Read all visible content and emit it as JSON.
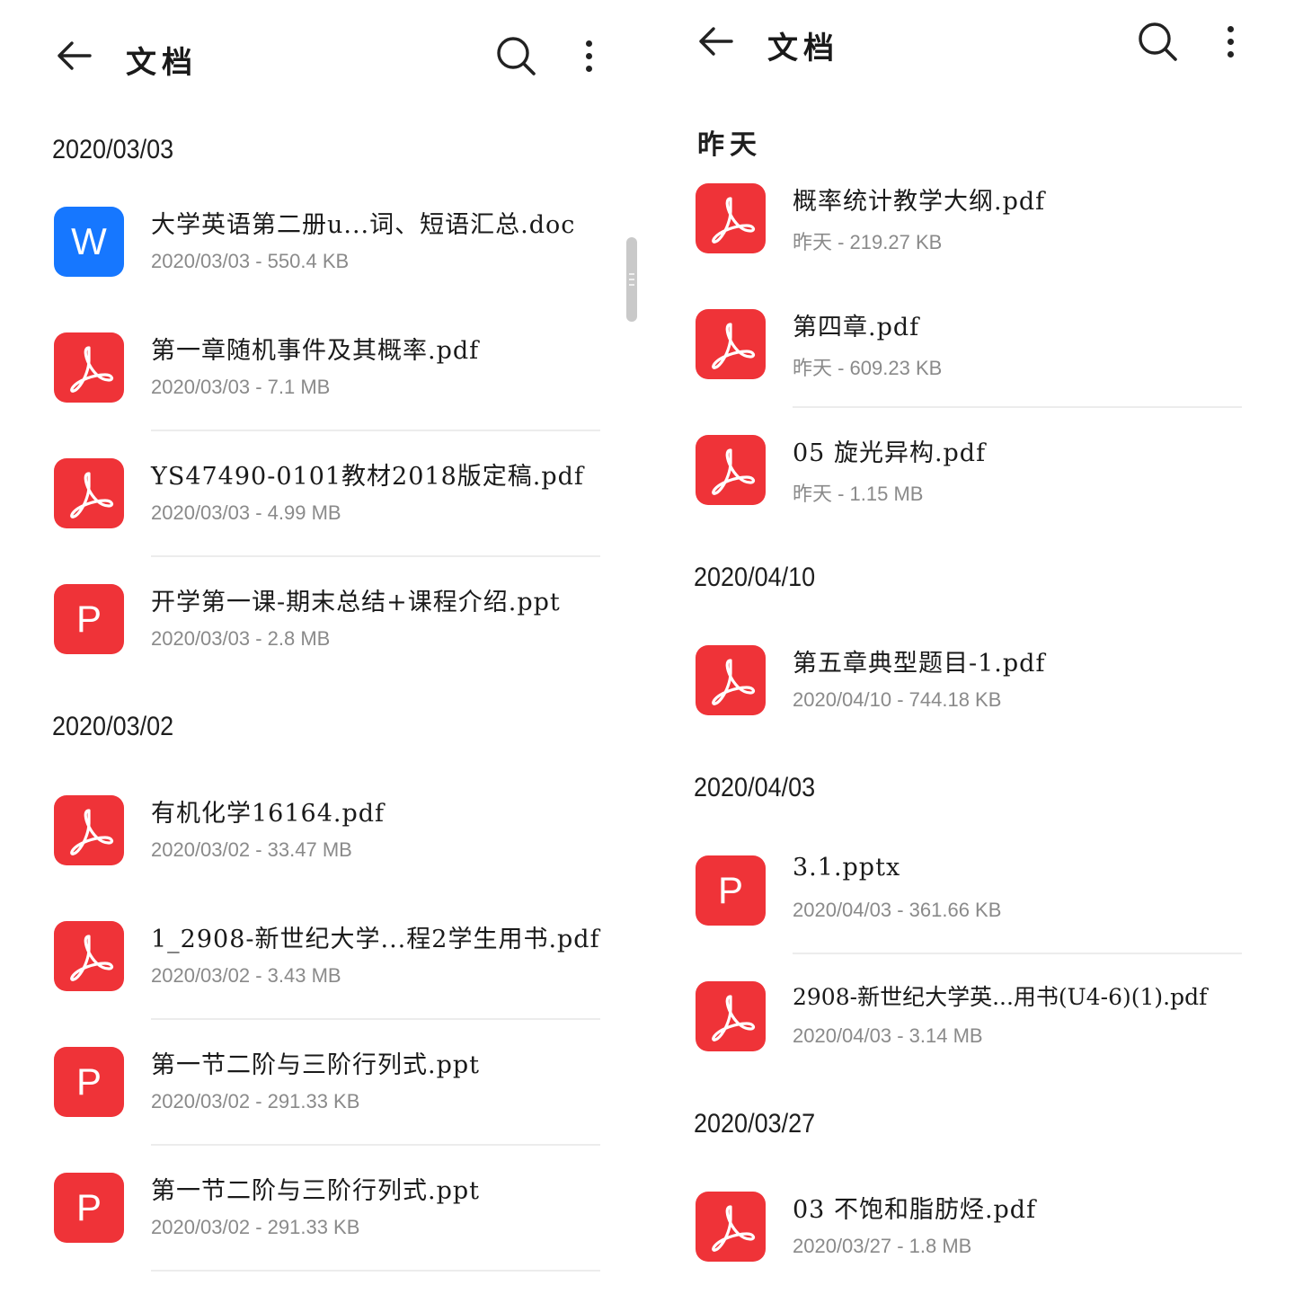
{
  "left": {
    "title": "文档",
    "sections": [
      {
        "date": "2020/03/03",
        "files": [
          {
            "type": "doc",
            "icon": "W",
            "name": "大学英语第二册u...词、短语汇总.doc",
            "meta": "2020/03/03 - 550.4 KB"
          },
          {
            "type": "pdf",
            "name": "第一章随机事件及其概率.pdf",
            "meta": "2020/03/03 - 7.1 MB"
          },
          {
            "type": "pdf",
            "name": "YS47490-0101教材2018版定稿.pdf",
            "meta": "2020/03/03 - 4.99 MB"
          },
          {
            "type": "ppt",
            "icon": "P",
            "name": "开学第一课-期末总结+课程介绍.ppt",
            "meta": "2020/03/03 - 2.8 MB"
          }
        ]
      },
      {
        "date": "2020/03/02",
        "files": [
          {
            "type": "pdf",
            "name": "有机化学16164.pdf",
            "meta": "2020/03/02 - 33.47 MB"
          },
          {
            "type": "pdf",
            "name": "1_2908-新世纪大学...程2学生用书.pdf",
            "meta": "2020/03/02 - 3.43 MB"
          },
          {
            "type": "ppt",
            "icon": "P",
            "name": "第一节二阶与三阶行列式.ppt",
            "meta": "2020/03/02 - 291.33 KB"
          },
          {
            "type": "ppt",
            "icon": "P",
            "name": "第一节二阶与三阶行列式.ppt",
            "meta": "2020/03/02 - 291.33 KB"
          }
        ]
      }
    ]
  },
  "right": {
    "title": "文档",
    "sections": [
      {
        "date": "昨天",
        "files": [
          {
            "type": "pdf",
            "name": "概率统计教学大纲.pdf",
            "meta": "昨天 - 219.27 KB"
          },
          {
            "type": "pdf",
            "name": "第四章.pdf",
            "meta": "昨天 - 609.23 KB"
          },
          {
            "type": "pdf",
            "name": "05 旋光异构.pdf",
            "meta": "昨天 - 1.15 MB"
          }
        ]
      },
      {
        "date": "2020/04/10",
        "files": [
          {
            "type": "pdf",
            "name": "第五章典型题目-1.pdf",
            "meta": "2020/04/10 - 744.18 KB"
          }
        ]
      },
      {
        "date": "2020/04/03",
        "files": [
          {
            "type": "ppt",
            "icon": "P",
            "name": "3.1.pptx",
            "meta": "2020/04/03 - 361.66 KB"
          },
          {
            "type": "pdf",
            "name": "2908-新世纪大学英...用书(U4-6)(1).pdf",
            "meta": "2020/04/03 - 3.14 MB"
          }
        ]
      },
      {
        "date": "2020/03/27",
        "files": [
          {
            "type": "pdf",
            "name": "03 不饱和脂肪烃.pdf",
            "meta": "2020/03/27 - 1.8 MB"
          }
        ]
      }
    ]
  }
}
